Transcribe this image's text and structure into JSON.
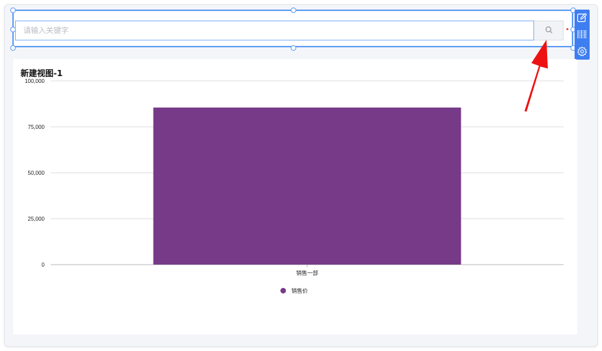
{
  "search": {
    "placeholder": "请输入关键字",
    "value": ""
  },
  "toolbar": {
    "icons": [
      "edit-icon",
      "barcode-icon",
      "settings-icon"
    ],
    "color": "#3f7ef0"
  },
  "chart": {
    "title": "新建视图-1"
  },
  "chart_data": {
    "type": "bar",
    "title": "新建视图-1",
    "categories": [
      "销售一部"
    ],
    "series": [
      {
        "name": "销售价",
        "values": [
          85500
        ],
        "color": "#763a88"
      }
    ],
    "ylim": [
      0,
      100000
    ],
    "yticks": [
      "0",
      "25,000",
      "50,000",
      "75,000",
      "100,000"
    ],
    "yticks_values": [
      0,
      25000,
      50000,
      75000,
      100000
    ],
    "xlabel": "",
    "ylabel": "",
    "grid": true,
    "legend_position": "bottom-center"
  },
  "annotation": {
    "arrow_color": "#ee1111"
  }
}
